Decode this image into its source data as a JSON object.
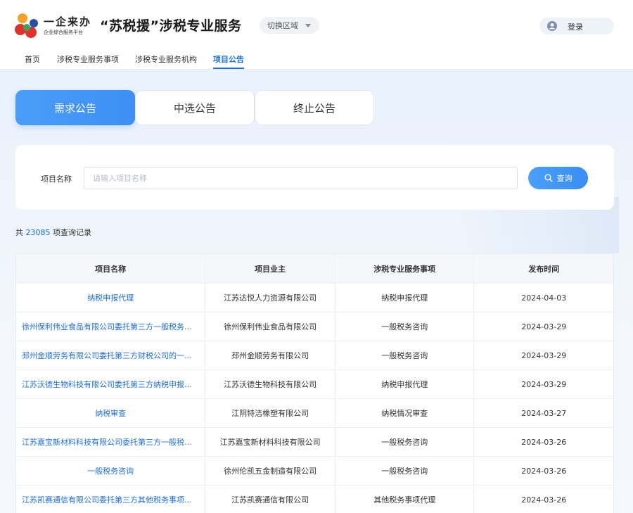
{
  "header": {
    "logo_main": "一企来办",
    "logo_sub": "企业综合服务平台",
    "site_title": "“苏税援”涉税专业服务",
    "region_switch": "切换区域",
    "login": "登录"
  },
  "nav": [
    {
      "label": "首页"
    },
    {
      "label": "涉税专业服务事项"
    },
    {
      "label": "涉税专业服务机构"
    },
    {
      "label": "项目公告",
      "active": true
    }
  ],
  "tabs": [
    {
      "label": "需求公告",
      "active": true
    },
    {
      "label": "中选公告"
    },
    {
      "label": "终止公告"
    }
  ],
  "search": {
    "label": "项目名称",
    "placeholder": "请输入项目名称",
    "value": "",
    "button": "查询"
  },
  "records": {
    "prefix": "共",
    "count": "23085",
    "suffix": "项查询记录"
  },
  "table": {
    "headers": [
      "项目名称",
      "项目业主",
      "涉税专业服务事项",
      "发布时间"
    ],
    "rows": [
      {
        "name": "纳税申报代理",
        "owner": "江苏达悦人力资源有限公司",
        "service": "纳税申报代理",
        "date": "2024-04-03"
      },
      {
        "name": "徐州保利伟业食品有限公司委托第三方一般税务…",
        "owner": "徐州保利伟业食品有限公司",
        "service": "一般税务咨询",
        "date": "2024-03-29"
      },
      {
        "name": "邳州金顺劳务有限公司委托第三方财税公司的一…",
        "owner": "邳州金顺劳务有限公司",
        "service": "一般税务咨询",
        "date": "2024-03-29"
      },
      {
        "name": "江苏沃德生物科技有限公司委托第三方纳税申报…",
        "owner": "江苏沃德生物科技有限公司",
        "service": "纳税申报代理",
        "date": "2024-03-29"
      },
      {
        "name": "纳税审查",
        "owner": "江阴特洁橡塑有限公司",
        "service": "纳税情况审查",
        "date": "2024-03-27"
      },
      {
        "name": "江苏嘉宝新材料科技有限公司委托第三方一般税…",
        "owner": "江苏嘉宝新材料科技有限公司",
        "service": "一般税务咨询",
        "date": "2024-03-26"
      },
      {
        "name": "一般税务咨询",
        "owner": "徐州伦凯五金制造有限公司",
        "service": "一般税务咨询",
        "date": "2024-03-26"
      },
      {
        "name": "江苏凯赛通信有限公司委托第三方其他税务事项…",
        "owner": "江苏凯赛通信有限公司",
        "service": "其他税务事项代理",
        "date": "2024-03-26"
      }
    ]
  },
  "colors": {
    "accent": "#3d8ff5",
    "link": "#1f6fd8",
    "logo_red": "#e0322b",
    "logo_green": "#3aa55a",
    "logo_blue": "#2a4fa0",
    "logo_orange": "#f3a12b"
  },
  "icons": {
    "logo": "brand-logo-icon",
    "user": "user-icon",
    "search": "search-icon",
    "caret": "caret-down-icon"
  }
}
